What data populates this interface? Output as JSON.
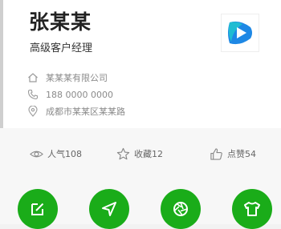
{
  "profile": {
    "name": "张某某",
    "title": "高级客户经理"
  },
  "info": {
    "company": "某某某有限公司",
    "phone": "188 0000 0000",
    "address": "成都市某某区某某路"
  },
  "stats": {
    "views": "人气108",
    "favorites": "收藏12",
    "likes": "点赞54"
  },
  "actions": [
    {
      "icon": "edit-icon"
    },
    {
      "icon": "send-location-icon"
    },
    {
      "icon": "aperture-icon"
    },
    {
      "icon": "shirt-icon"
    }
  ],
  "colors": {
    "accent_green": "#1aac19",
    "logo_blue": "#1e88e5",
    "logo_teal": "#1fbcd2"
  }
}
